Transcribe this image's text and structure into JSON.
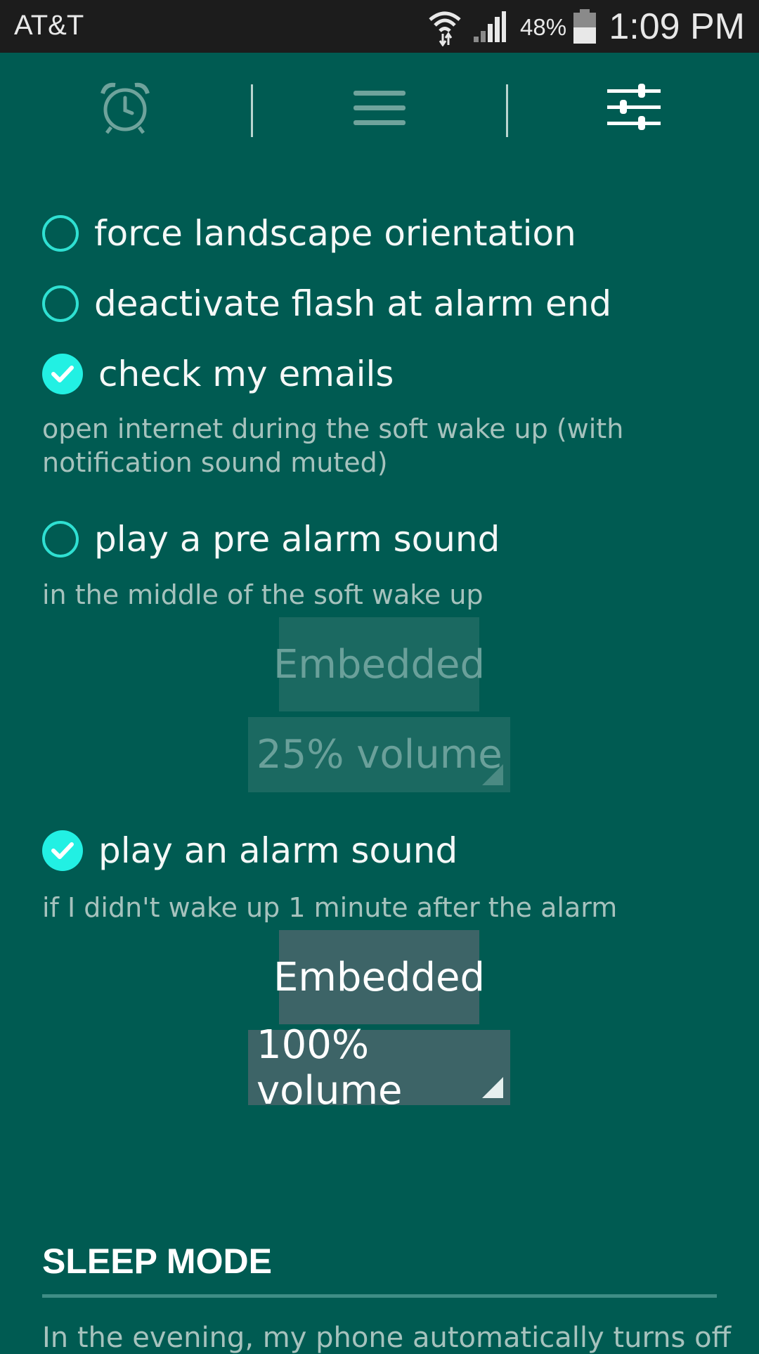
{
  "status_bar": {
    "carrier": "AT&T",
    "battery": "48%",
    "time": "1:09 PM",
    "icons": [
      "wifi-icon",
      "signal-icon",
      "battery-icon"
    ]
  },
  "nav": {
    "tabs": [
      {
        "icon": "alarm-clock-icon",
        "active": false
      },
      {
        "icon": "menu-icon",
        "active": false
      },
      {
        "icon": "sliders-icon",
        "active": true
      }
    ]
  },
  "options": {
    "landscape": {
      "label": "force landscape orientation",
      "checked": false
    },
    "flash": {
      "label": "deactivate flash at alarm end",
      "checked": false
    },
    "emails": {
      "label": "check my emails",
      "checked": true,
      "desc": "open internet during the soft wake up (with notification sound muted)"
    },
    "pre_alarm": {
      "label": "play a pre alarm sound",
      "checked": false,
      "desc": "in the middle of the soft wake up",
      "sound": "Embedded",
      "volume": "25% volume"
    },
    "alarm": {
      "label": "play an alarm sound",
      "checked": true,
      "desc": "if I didn't wake up 1 minute after the alarm",
      "sound": "Embedded",
      "volume": "100% volume"
    }
  },
  "sleep_mode": {
    "title": "SLEEP MODE",
    "text": "In the evening, my phone automatically turns off"
  },
  "colors": {
    "background": "#005b52",
    "accent": "#22f0e3",
    "status_bar": "#1c1c1c"
  }
}
